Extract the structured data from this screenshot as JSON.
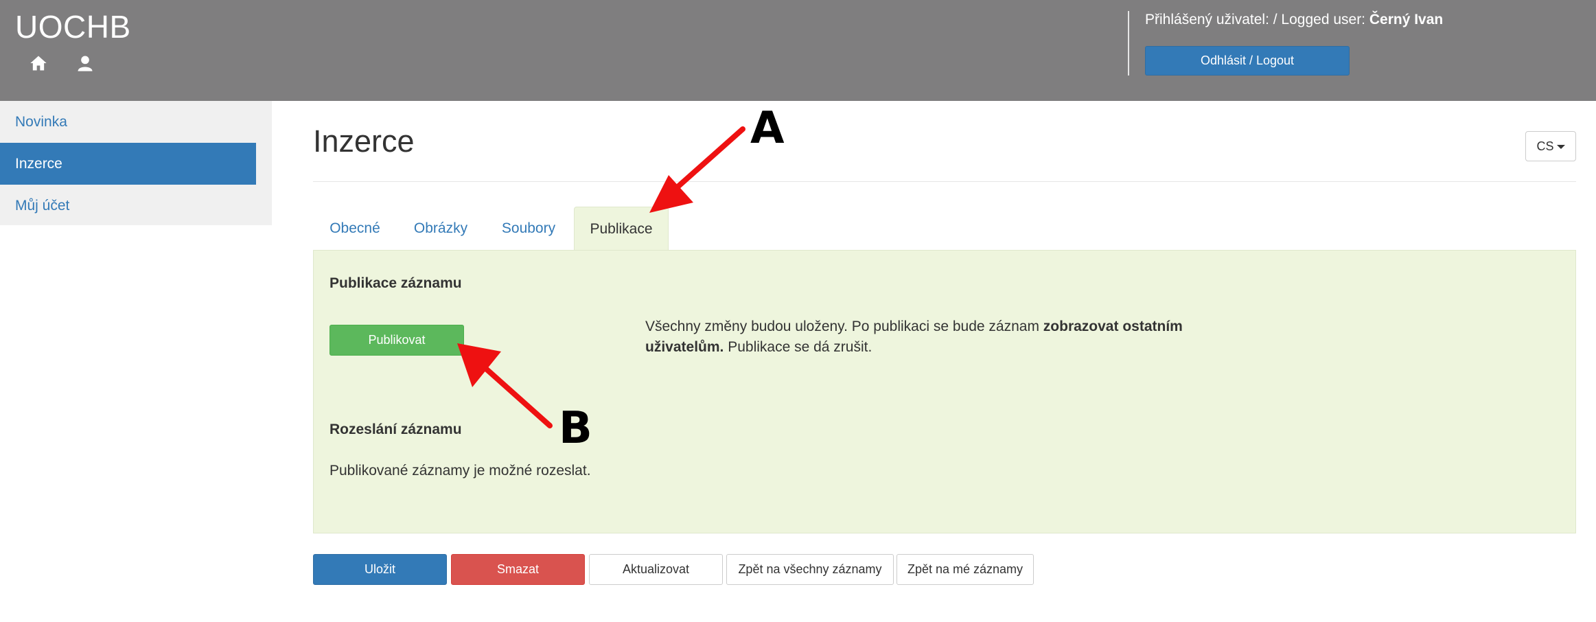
{
  "header": {
    "brand": "UOCHB",
    "logged_label": "Přihlášený uživatel: / Logged user: ",
    "logged_name": "Černý Ivan",
    "logout_label": "Odhlásit / Logout"
  },
  "sidebar": {
    "items": [
      {
        "label": "Novinka"
      },
      {
        "label": "Inzerce"
      },
      {
        "label": "Můj účet"
      }
    ]
  },
  "main": {
    "title": "Inzerce",
    "lang": "CS",
    "tabs": [
      {
        "label": "Obecné"
      },
      {
        "label": "Obrázky"
      },
      {
        "label": "Soubory"
      },
      {
        "label": "Publikace"
      }
    ],
    "publish_title": "Publikace záznamu",
    "publish_button": "Publikovat",
    "desc_part1": "Všechny změny budou uloženy. Po publikaci se bude záznam ",
    "desc_bold": "zobrazovat ostatním uživatelům.",
    "desc_part2": " Publikace se dá zrušit.",
    "send_title": "Rozeslání záznamu",
    "send_text": "Publikované záznamy je možné rozeslat."
  },
  "actions": {
    "save": "Uložit",
    "delete": "Smazat",
    "update": "Aktualizovat",
    "back_all": "Zpět na všechny záznamy",
    "back_mine": "Zpět na mé záznamy"
  },
  "annotations": {
    "label_a": "A",
    "label_b": "B",
    "arrow_color": "#ee1111"
  },
  "colors": {
    "header_bg": "#7f7e7f",
    "primary": "#337ab7",
    "success": "#5cb85c",
    "danger": "#d9534f",
    "panel_bg": "#eef5dd"
  }
}
